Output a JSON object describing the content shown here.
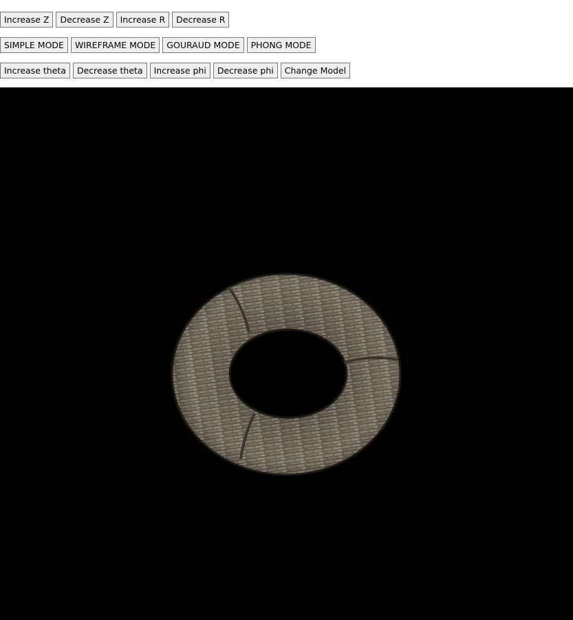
{
  "toolbar": {
    "row1": {
      "increase_z": "Increase Z",
      "decrease_z": "Decrease Z",
      "increase_r": "Increase R",
      "decrease_r": "Decrease R"
    },
    "row2": {
      "simple_mode": "SIMPLE MODE",
      "wireframe_mode": "WIREFRAME MODE",
      "gouraud_mode": "GOURAUD MODE",
      "phong_mode": "PHONG MODE"
    },
    "row3": {
      "increase_theta": "Increase theta",
      "decrease_theta": "Decrease theta",
      "increase_phi": "Increase phi",
      "decrease_phi": "Decrease phi",
      "change_model": "Change Model"
    }
  },
  "scene": {
    "model": "torus",
    "texture": "stone-brick",
    "background_color": "#000000"
  }
}
